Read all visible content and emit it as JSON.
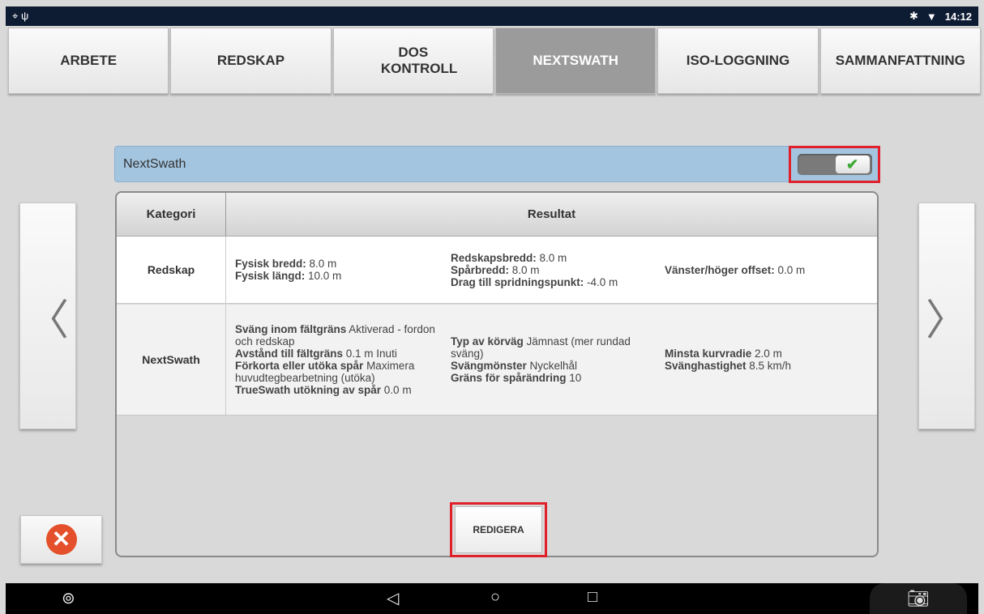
{
  "status_bar": {
    "left_icons": [
      "gps-icon",
      "usb-icon"
    ],
    "right_icons": [
      "bluetooth-icon",
      "wifi-icon"
    ],
    "time": "14:12"
  },
  "tabs": [
    {
      "label": "ARBETE",
      "active": false
    },
    {
      "label": "REDSKAP",
      "active": false
    },
    {
      "label": "DOS KONTROLL",
      "active": false
    },
    {
      "label": "NEXTSWATH",
      "active": true
    },
    {
      "label": "ISO-LOGGNING",
      "active": false
    },
    {
      "label": "SAMMANFATTNING",
      "active": false
    }
  ],
  "nextswath": {
    "title": "NextSwath",
    "toggle_on": true
  },
  "table": {
    "header": {
      "category": "Kategori",
      "result": "Resultat"
    },
    "rows": [
      {
        "category": "Redskap",
        "col_a": [
          {
            "label": "Fysisk bredd:",
            "value": " 8.0 m"
          },
          {
            "label": "Fysisk längd:",
            "value": " 10.0 m"
          }
        ],
        "col_b": [
          {
            "label": "Redskapsbredd:",
            "value": " 8.0 m"
          },
          {
            "label": "Spårbredd:",
            "value": " 8.0 m"
          },
          {
            "label": "Drag till spridningspunkt:",
            "value": " -4.0 m"
          }
        ],
        "col_c": [
          {
            "label": "Vänster/höger offset:",
            "value": " 0.0 m"
          }
        ]
      },
      {
        "category": "NextSwath",
        "col_a": [
          {
            "label": "Sväng inom fältgräns",
            "value": " Aktiverad - fordon och redskap"
          },
          {
            "label": "Avstånd till fältgräns",
            "value": " 0.1 m Inuti"
          },
          {
            "label": "Förkorta eller utöka spår",
            "value": " Maximera huvudtegbearbetning (utöka)"
          },
          {
            "label": "TrueSwath utökning av spår",
            "value": " 0.0 m"
          }
        ],
        "col_b": [
          {
            "label": "Typ av körväg",
            "value": " Jämnast (mer rundad sväng)"
          },
          {
            "label": "Svängmönster",
            "value": " Nyckelhål"
          },
          {
            "label": "Gräns för spårändring",
            "value": " 10"
          }
        ],
        "col_c": [
          {
            "label": "Minsta kurvradie",
            "value": " 2.0 m"
          },
          {
            "label": "Svänghastighet",
            "value": " 8.5 km/h"
          }
        ]
      }
    ]
  },
  "buttons": {
    "edit": "REDIGERA"
  },
  "colors": {
    "highlight": "#e0202b",
    "header_bar": "#a3c5e0",
    "active_tab": "#9b9b9b"
  }
}
